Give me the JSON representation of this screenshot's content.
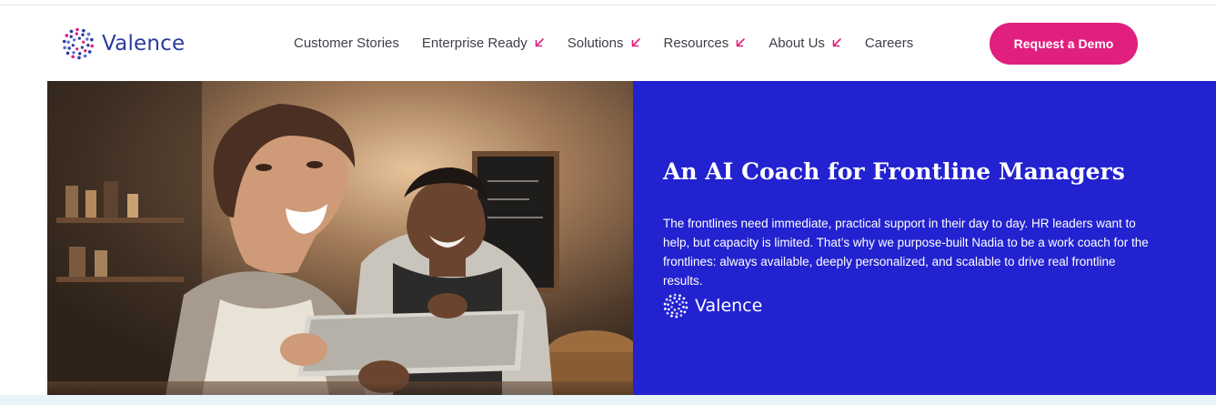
{
  "brand": {
    "name": "Valence",
    "logo_icon": "dotted-circle-logo",
    "colors": {
      "logo_navy": "#2a3a9e",
      "accent_pink": "#e01f7e",
      "hero_blue": "#2222d0"
    }
  },
  "nav": {
    "items": [
      {
        "label": "Customer Stories",
        "has_dropdown": false
      },
      {
        "label": "Enterprise Ready",
        "has_dropdown": true,
        "icon": "arrow-down-left-icon"
      },
      {
        "label": "Solutions",
        "has_dropdown": true,
        "icon": "arrow-down-left-icon"
      },
      {
        "label": "Resources",
        "has_dropdown": true,
        "icon": "arrow-down-left-icon"
      },
      {
        "label": "About Us",
        "has_dropdown": true,
        "icon": "arrow-down-left-icon"
      },
      {
        "label": "Careers",
        "has_dropdown": false
      }
    ],
    "cta_label": "Request a Demo"
  },
  "hero": {
    "image_alt": "Smiling woman and man in aprons looking at a tablet in a cafe",
    "title": "An AI Coach for Frontline Managers",
    "body": "The frontlines need immediate, practical support in their day to day. HR leaders want to help, but capacity is limited. That’s why we purpose-built Nadia to be a work coach for the frontlines: always available, deeply personalized, and scalable to drive real frontline results.",
    "logo_text": "Valence"
  }
}
